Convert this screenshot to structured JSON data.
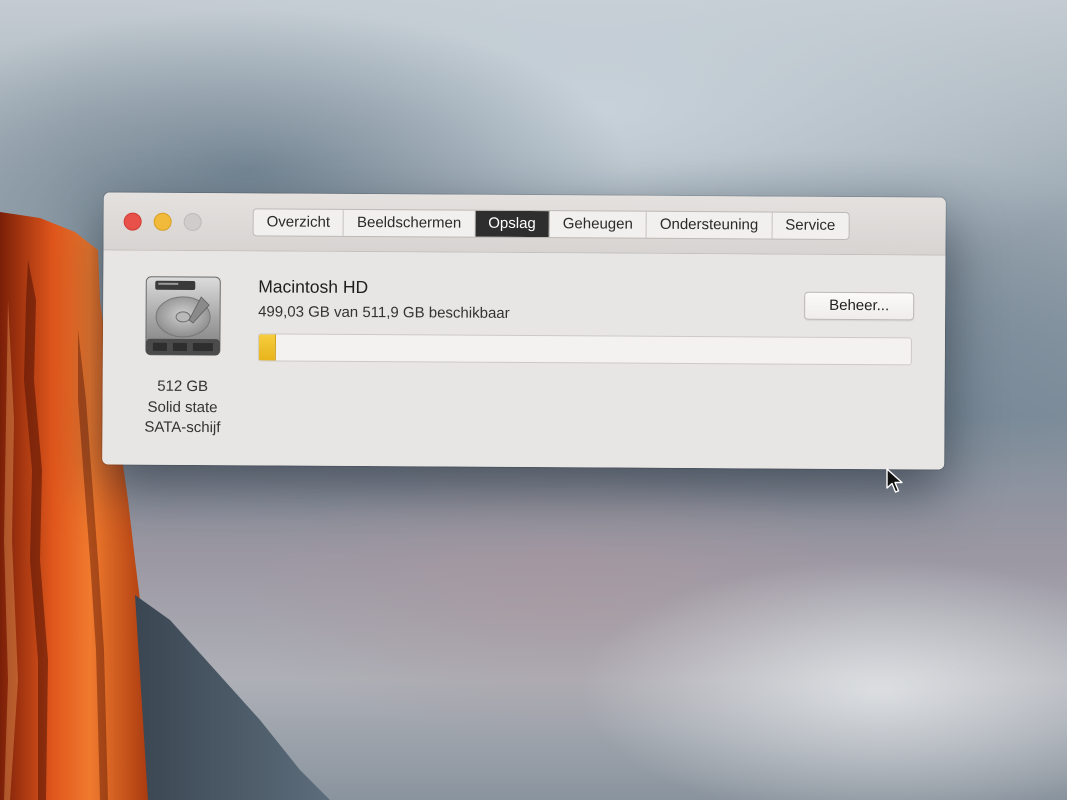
{
  "window": {
    "tabs": [
      {
        "label": "Overzicht",
        "active": false
      },
      {
        "label": "Beeldschermen",
        "active": false
      },
      {
        "label": "Opslag",
        "active": true
      },
      {
        "label": "Geheugen",
        "active": false
      },
      {
        "label": "Ondersteuning",
        "active": false
      },
      {
        "label": "Service",
        "active": false
      }
    ]
  },
  "disk": {
    "capacity": "512 GB",
    "type": "Solid state",
    "interface": "SATA-schijf",
    "name": "Macintosh HD",
    "available_text": "499,03 GB van 511,9 GB beschikbaar",
    "used_fraction": 0.025,
    "manage_label": "Beheer..."
  },
  "colors": {
    "usage_fill": "#f0c22c",
    "active_tab": "#2f2e2e",
    "close": "#e8504a",
    "minimize": "#f1ba3a",
    "zoom": "#cfcccb"
  },
  "icons": {
    "disk": "hard-drive-icon",
    "pointer": "mouse-cursor-icon"
  }
}
